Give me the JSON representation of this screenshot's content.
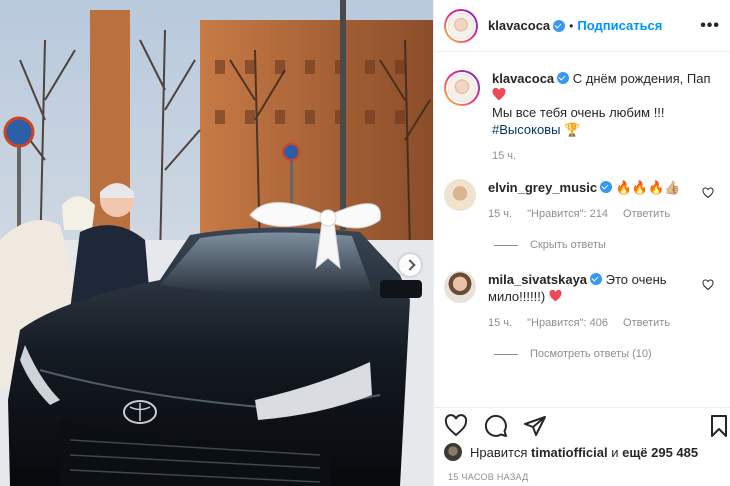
{
  "post_header": {
    "username": "klavacoca",
    "separator": "•",
    "follow_label": "Подписаться",
    "more_label": "•••"
  },
  "caption": {
    "username": "klavacoca",
    "line1": "С днём рождения, Пап",
    "line2": "Мы все тебя очень любим !!!",
    "hashtag": "#Высоковы",
    "time": "15 ч."
  },
  "comments": [
    {
      "username": "elvin_grey_music",
      "text": "🔥🔥🔥👍🏼",
      "time": "15 ч.",
      "likes": "\"Нравится\": 214",
      "reply_label": "Ответить",
      "replies_toggle": "Скрыть ответы"
    },
    {
      "username": "mila_sivatskaya",
      "text": "Это очень мило!!!!!!)",
      "time": "15 ч.",
      "likes": "\"Нравится\": 406",
      "reply_label": "Ответить",
      "replies_toggle": "Посмотреть ответы (10)"
    }
  ],
  "likes_line": {
    "prefix": "Нравится",
    "user": "timatiofficial",
    "suffix": "и",
    "count": "ещё 295 485"
  },
  "post_time": "15 ЧАСОВ НАЗАД",
  "icons": [
    "heart-icon",
    "comment-icon",
    "share-icon",
    "bookmark-icon",
    "verified-icon",
    "more-icon",
    "next-arrow-icon"
  ],
  "colors": {
    "link_blue": "#0095f6",
    "verified_blue": "#3897f0",
    "muted_text": "#8e8e8e",
    "heart_red": "#ed4956"
  }
}
